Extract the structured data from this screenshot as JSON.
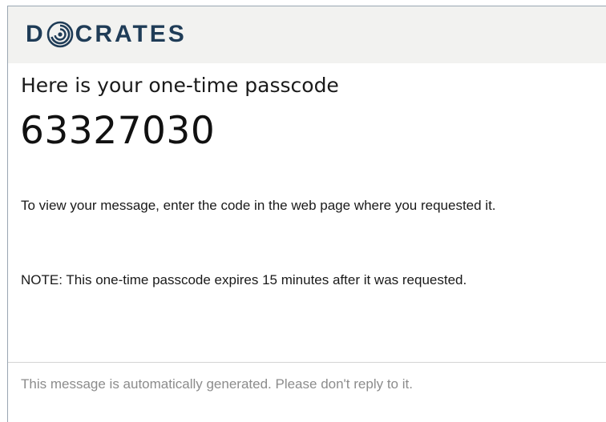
{
  "brand": {
    "logo_text_left": "D",
    "logo_text_right": "CRATES",
    "brand_color": "#1f3c57",
    "logo_mark_icon": "concentric-circles-icon"
  },
  "message": {
    "intro": "Here is your one-time passcode",
    "passcode": "63327030",
    "instructions": "To view your message, enter the code in the web page where you requested it.",
    "note": "NOTE: This one-time passcode expires 15 minutes after it was requested."
  },
  "footer": {
    "text": "This message is automatically generated. Please don't reply to it."
  }
}
